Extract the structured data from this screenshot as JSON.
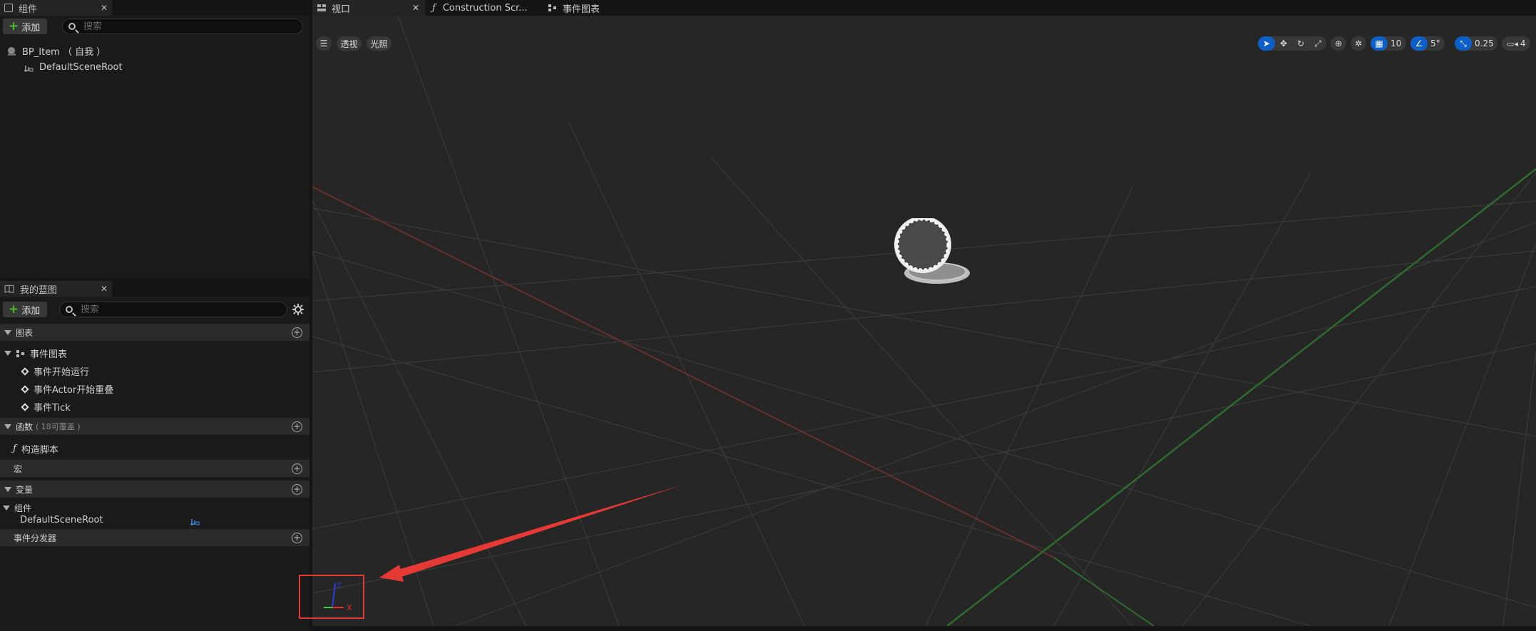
{
  "components_panel": {
    "tab_title": "组件",
    "add_label": "添加",
    "search_placeholder": "搜索",
    "tree": [
      {
        "label": "BP_Item （ 自我 ）"
      },
      {
        "label": "DefaultSceneRoot"
      }
    ]
  },
  "blueprint_panel": {
    "tab_title": "我的蓝图",
    "add_label": "添加",
    "search_placeholder": "搜索",
    "sections": {
      "graphs": "图表",
      "event_graph": "事件图表",
      "events": [
        "事件开始运行",
        "事件Actor开始重叠",
        "事件Tick"
      ],
      "functions": "函数",
      "functions_note": "( 18可覆盖 )",
      "construction_script": "构造脚本",
      "macros": "宏",
      "variables": "变量",
      "components_category": "组件",
      "component_var": "DefaultSceneRoot",
      "dispatchers": "事件分发器"
    }
  },
  "editor_tabs": {
    "viewport": "视口",
    "construction": "Construction Scr...",
    "event_graph": "事件图表"
  },
  "viewport_toolbar": {
    "perspective": "透视",
    "lighting": "光照",
    "grid_snap": "10",
    "rotation_snap": "5°",
    "scale_snap": "0.25",
    "camera_speed": "4"
  },
  "axis_indicator": {
    "x_label": "X"
  },
  "colors": {
    "accent": "#0d5fc6",
    "highlight_box": "#e53935",
    "add_green": "#4fbe2a"
  }
}
